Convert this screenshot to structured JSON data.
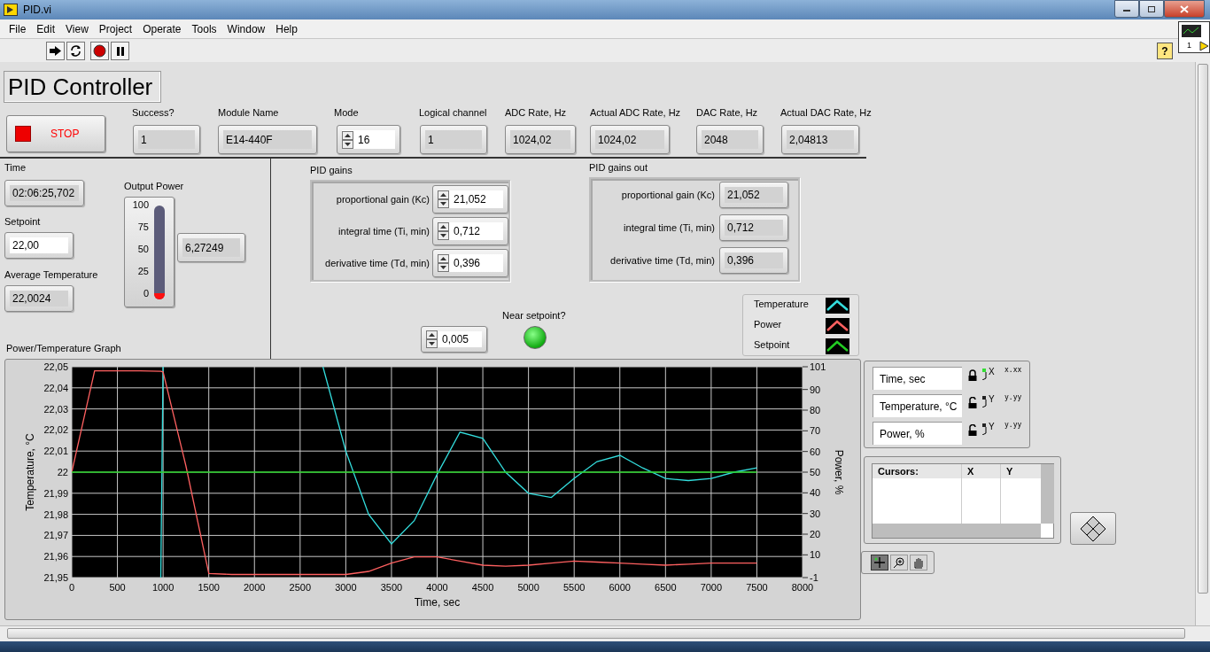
{
  "window": {
    "title": "PID.vi"
  },
  "menu": [
    "File",
    "Edit",
    "View",
    "Project",
    "Operate",
    "Tools",
    "Window",
    "Help"
  ],
  "help_button": "?",
  "vi_icon_label": "1",
  "panel": {
    "title": "PID Controller",
    "stop_button": {
      "label": "STOP"
    },
    "top_fields": [
      {
        "label": "Success?",
        "value": "1",
        "kind": "indicator"
      },
      {
        "label": "Module Name",
        "value": "E14-440F",
        "kind": "indicator"
      },
      {
        "label": "Mode",
        "value": "16",
        "kind": "spin_control"
      },
      {
        "label": "Logical channel",
        "value": "1",
        "kind": "indicator"
      },
      {
        "label": "ADC Rate, Hz",
        "value": "1024,02",
        "kind": "indicator"
      },
      {
        "label": "Actual ADC Rate, Hz",
        "value": "1024,02",
        "kind": "indicator"
      },
      {
        "label": "DAC Rate, Hz",
        "value": "2048",
        "kind": "indicator"
      },
      {
        "label": "Actual DAC Rate, Hz",
        "value": "2,04813",
        "kind": "indicator"
      }
    ],
    "left_fields": [
      {
        "label": "Time",
        "value": "02:06:25,702",
        "kind": "indicator"
      },
      {
        "label": "Setpoint",
        "value": "22,00",
        "kind": "control"
      },
      {
        "label": "Average Temperature",
        "value": "22,0024",
        "kind": "indicator"
      }
    ],
    "output_power": {
      "label": "Output Power",
      "ticks": [
        "100",
        "75",
        "50",
        "25",
        "0"
      ],
      "level": 0.063,
      "value": "6,27249"
    },
    "pid_gains": {
      "label": "PID gains",
      "fields": [
        {
          "label": "proportional gain (Kc)",
          "value": "21,052",
          "kind": "spin_control"
        },
        {
          "label": "integral time (Ti, min)",
          "value": "0,712",
          "kind": "spin_control"
        },
        {
          "label": "derivative time (Td, min)",
          "value": "0,396",
          "kind": "spin_control"
        }
      ]
    },
    "pid_gains_out": {
      "label": "PID gains out",
      "fields": [
        {
          "label": "proportional gain (Kc)",
          "value": "21,052",
          "kind": "indicator"
        },
        {
          "label": "integral time (Ti, min)",
          "value": "0,712",
          "kind": "indicator"
        },
        {
          "label": "derivative time (Td, min)",
          "value": "0,396",
          "kind": "indicator"
        }
      ]
    },
    "tolerance": {
      "value": "0,005",
      "kind": "spin_control"
    },
    "near_setpoint": {
      "label": "Near setpoint?",
      "on": true
    },
    "graph": {
      "label": "Power/Temperature Graph",
      "chart_data": {
        "type": "line",
        "xlabel": "Time, sec",
        "ylabel": "Temperature, °C",
        "y2label": "Power, %",
        "x": [
          0,
          250,
          500,
          750,
          975,
          1000,
          1250,
          1500,
          1750,
          2000,
          2250,
          2500,
          2750,
          3000,
          3250,
          3500,
          3750,
          4000,
          4250,
          4500,
          4750,
          5000,
          5250,
          5500,
          5750,
          6000,
          6250,
          6500,
          6750,
          7000,
          7250,
          7500
        ],
        "series": [
          {
            "name": "Temperature",
            "color": "#33dddd",
            "values": [
              null,
              null,
              null,
              null,
              21.95,
              22.05,
              null,
              null,
              null,
              null,
              null,
              null,
              22.05,
              22.01,
              21.98,
              21.966,
              21.977,
              21.999,
              22.019,
              22.016,
              22.0,
              21.99,
              21.988,
              21.997,
              22.005,
              22.008,
              22.002,
              21.997,
              21.996,
              21.997,
              22.0,
              22.002
            ]
          },
          {
            "name": "Power",
            "color": "#ff6060",
            "axis": "y2",
            "values": [
              50,
              99,
              99,
              99,
              98.8,
              98.5,
              53,
              1,
              0.5,
              0.5,
              0.5,
              0.5,
              0.5,
              0.5,
              2,
              6,
              9,
              9,
              7,
              5,
              4.5,
              5,
              6,
              7,
              6.5,
              6,
              5.5,
              5,
              5.5,
              6,
              6,
              6
            ]
          },
          {
            "name": "Setpoint",
            "color": "#22cc22",
            "values": [
              22,
              22,
              22,
              22,
              22,
              22,
              22,
              22,
              22,
              22,
              22,
              22,
              22,
              22,
              22,
              22,
              22,
              22,
              22,
              22,
              22,
              22,
              22,
              22,
              22,
              22,
              22,
              22,
              22,
              22,
              22,
              22
            ]
          }
        ],
        "grid": true,
        "xlim": [
          0,
          8000
        ],
        "ylim": [
          21.95,
          22.05
        ],
        "y2lim": [
          -1,
          101
        ],
        "xticks": [
          0,
          500,
          1000,
          1500,
          2000,
          2500,
          3000,
          3500,
          4000,
          4500,
          5000,
          5500,
          6000,
          6500,
          7000,
          7500,
          8000
        ],
        "yticks": [
          {
            "value": 22.05,
            "label": "22,05"
          },
          {
            "value": 22.04,
            "label": "22,04"
          },
          {
            "value": 22.03,
            "label": "22,03"
          },
          {
            "value": 22.02,
            "label": "22,02"
          },
          {
            "value": 22.01,
            "label": "22,01"
          },
          {
            "value": 22,
            "label": "22"
          },
          {
            "value": 21.99,
            "label": "21,99"
          },
          {
            "value": 21.98,
            "label": "21,98"
          },
          {
            "value": 21.97,
            "label": "21,97"
          },
          {
            "value": 21.96,
            "label": "21,96"
          },
          {
            "value": 21.95,
            "label": "21,95"
          }
        ],
        "y2ticks": [
          101,
          90,
          80,
          70,
          60,
          50,
          40,
          30,
          20,
          10,
          -1
        ]
      }
    },
    "scale_legend": [
      {
        "name": "Time, sec",
        "locked": true,
        "autoscale": true,
        "axis_letter": "X",
        "format": "x.xx"
      },
      {
        "name": "Temperature, °C",
        "locked": false,
        "autoscale": false,
        "axis_letter": "Y",
        "format": "y.yy"
      },
      {
        "name": "Power, %",
        "locked": false,
        "autoscale": false,
        "axis_letter": "Y",
        "format": "y.yy"
      }
    ],
    "cursor_legend": {
      "columns": [
        "Cursors:",
        "X",
        "Y"
      ]
    },
    "graph_tools": [
      {
        "kind": "cursor",
        "selected": true
      },
      {
        "kind": "zoom",
        "selected": false
      },
      {
        "kind": "pan",
        "selected": false
      }
    ]
  }
}
